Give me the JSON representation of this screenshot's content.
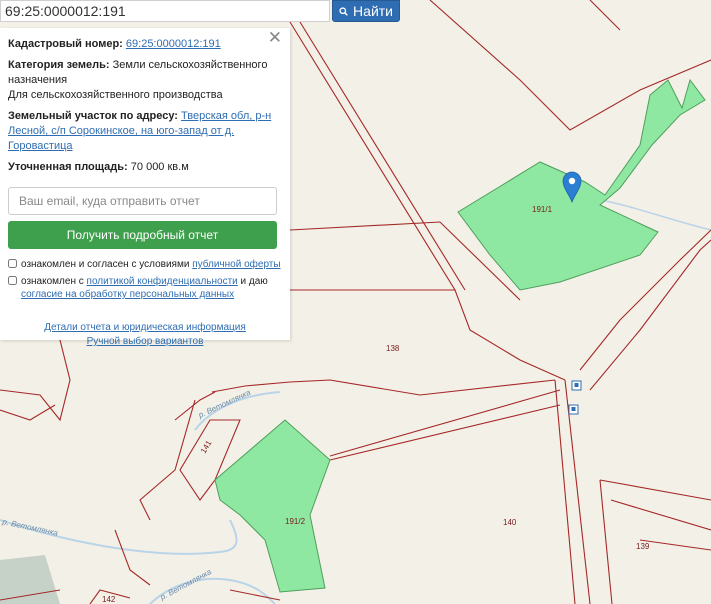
{
  "search": {
    "value": "69:25:0000012:191",
    "button_label": "Найти",
    "button_icon": "search-icon"
  },
  "panel": {
    "cadastral_label": "Кадастровый номер:",
    "cadastral_value": "69:25:0000012:191",
    "category_label": "Категория земель:",
    "category_value": "Земли сельскохозяйственного назначения",
    "usage_value": "Для сельскохозяйственного производства",
    "address_label": "Земельный участок по адресу:",
    "address_value": "Тверская обл, р-н Лесной, с/п Сорокинское, на юго-запад от д. Горовастица",
    "area_label": "Уточненная площадь:",
    "area_value": "70 000 кв.м",
    "email_placeholder": "Ваш email, куда отправить отчет",
    "report_button": "Получить подробный отчет",
    "checkbox1_text": "ознакомлен и согласен с условиями ",
    "checkbox1_link": "публичной оферты",
    "checkbox2_text": "ознакомлен с ",
    "checkbox2_link1": "политикой конфиденциальности",
    "checkbox2_mid": " и даю ",
    "checkbox2_link2": "согласие на обработку персональных данных",
    "details_link": "Детали отчета и юридическая информация",
    "manual_link": "Ручной выбор вариантов"
  },
  "map": {
    "parcel_labels": {
      "p191_1": "191/1",
      "p191_2": "191/2",
      "p138": "138",
      "p140": "140",
      "p139": "139",
      "p141": "141",
      "p142": "142"
    },
    "river_label1": "р. Ветомлянка",
    "river_label2": "р. Ветомлянка",
    "river_label3": "р. Ветомлянка",
    "parcel_fill": "#8fe8a2",
    "boundary_color": "#a52828",
    "marker_icon": "map-pin-icon",
    "bus_stop_icon": "bus-stop-icon"
  }
}
